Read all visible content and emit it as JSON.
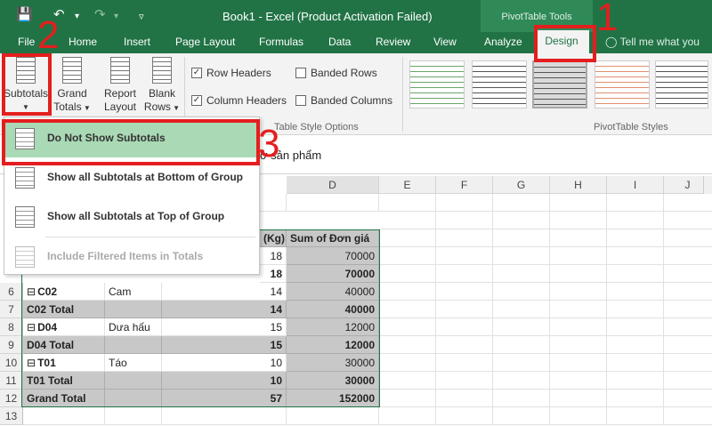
{
  "window": {
    "title": "Book1 - Excel (Product Activation Failed)",
    "contextual_group": "PivotTable Tools",
    "quick_access": {
      "save_icon": "save-icon",
      "undo_icon": "undo-icon",
      "redo_icon": "redo-icon",
      "customize_icon": "customize-icon"
    }
  },
  "tabs": [
    "File",
    "Home",
    "Insert",
    "Page Layout",
    "Formulas",
    "Data",
    "Review",
    "View",
    "Analyze",
    "Design"
  ],
  "active_tab": "Design",
  "tell_me": "Tell me what you",
  "ribbon": {
    "subtotals": "Subtotals",
    "grand_totals": [
      "Grand",
      "Totals"
    ],
    "report_layout": [
      "Report",
      "Layout"
    ],
    "blank_rows": [
      "Blank",
      "Rows"
    ],
    "row_headers": "Row Headers",
    "column_headers": "Column Headers",
    "banded_rows": "Banded Rows",
    "banded_columns": "Banded Columns",
    "row_headers_checked": true,
    "column_headers_checked": true,
    "style_options_group": "Table Style Options",
    "styles_group": "PivotTable Styles"
  },
  "formula_bar_fragment": "ở sản phẩm",
  "subtotals_menu": [
    {
      "label": "Do Not Show Subtotals",
      "highlighted": true,
      "disabled": false
    },
    {
      "label": "Show all Subtotals at Bottom of Group",
      "highlighted": false,
      "disabled": false
    },
    {
      "label": "Show all Subtotals at Top of Group",
      "highlighted": false,
      "disabled": false
    },
    {
      "label": "Include Filtered Items in Totals",
      "highlighted": false,
      "disabled": true
    }
  ],
  "columns": [
    "D",
    "E",
    "F",
    "G",
    "H",
    "I",
    "J"
  ],
  "sheet": {
    "header_c": "(Kg)",
    "header_d": "Sum of Đơn giá",
    "partial_rows": [
      {
        "c": "18",
        "d": "70000"
      },
      {
        "c": "18",
        "d": "70000"
      }
    ],
    "rows": [
      {
        "row": "6",
        "a": "C02",
        "b": "Cam",
        "c": "14",
        "d": "40000",
        "total": false,
        "collapse": true
      },
      {
        "row": "7",
        "a": "C02 Total",
        "b": "",
        "c": "14",
        "d": "40000",
        "total": true,
        "collapse": false
      },
      {
        "row": "8",
        "a": "D04",
        "b": "Dưa hấu",
        "c": "15",
        "d": "12000",
        "total": false,
        "collapse": true
      },
      {
        "row": "9",
        "a": "D04 Total",
        "b": "",
        "c": "15",
        "d": "12000",
        "total": true,
        "collapse": false
      },
      {
        "row": "10",
        "a": "T01",
        "b": "Táo",
        "c": "10",
        "d": "30000",
        "total": false,
        "collapse": true
      },
      {
        "row": "11",
        "a": "T01 Total",
        "b": "",
        "c": "10",
        "d": "30000",
        "total": true,
        "collapse": false
      },
      {
        "row": "12",
        "a": "Grand Total",
        "b": "",
        "c": "57",
        "d": "152000",
        "total": true,
        "collapse": false
      },
      {
        "row": "13",
        "a": "",
        "b": "",
        "c": "",
        "d": "",
        "total": false,
        "collapse": false
      }
    ]
  },
  "annotations": [
    "1",
    "2",
    "3"
  ],
  "colors": {
    "excel_green": "#217346",
    "highlight": "#a9d9b5",
    "annotation_red": "#e41e1e"
  }
}
